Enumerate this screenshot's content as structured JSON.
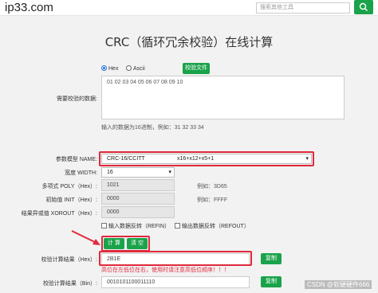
{
  "header": {
    "logo": "ip33.com",
    "search_placeholder": "搜索其他工具"
  },
  "page_title": "CRC（循环冗余校验）在线计算",
  "input_mode": {
    "options": [
      "Hex",
      "Ascii"
    ],
    "selected": "Hex",
    "check_file_label": "校验文件"
  },
  "data_input": {
    "label": "需要校验的数据:",
    "value": "01 02 03 04 05 06 07 08 09 10",
    "hint": "输入的数据为16进制，例如：31 32 33 34"
  },
  "params": {
    "model_label": "参数模型 NAME:",
    "model_name": "CRC-16/CCITT",
    "model_poly_desc": "x16+x12+x5+1",
    "width_label": "宽度 WIDTH:",
    "width_value": "16",
    "poly_label": "多项式 POLY（Hex）:",
    "poly_value": "1021",
    "poly_example": "例如：3D65",
    "init_label": "初始值 INIT（Hex）:",
    "init_value": "0000",
    "init_example": "例如：FFFF",
    "xorout_label": "结果异或值 XOROUT（Hex）:",
    "xorout_value": "0000",
    "refin_label": "输入数据反转（REFIN）",
    "refout_label": "输出数据反转（REFOUT）"
  },
  "actions": {
    "calculate": "计 算",
    "clear": "清 空"
  },
  "results": {
    "hex_label": "校验计算结果（Hex）:",
    "hex_value": "2B1E",
    "warning": "高位在左低位在右，使用时请注意高低位顺序！！！",
    "copy_label": "复制",
    "bin_label": "校验计算结果（Bin）:",
    "bin_value": "0010101100011110",
    "copy_label_2": "复制"
  },
  "watermark": "CSDN @软硬硬件666",
  "colors": {
    "accent_green": "#1aa34a",
    "highlight_red": "#e0293b"
  }
}
